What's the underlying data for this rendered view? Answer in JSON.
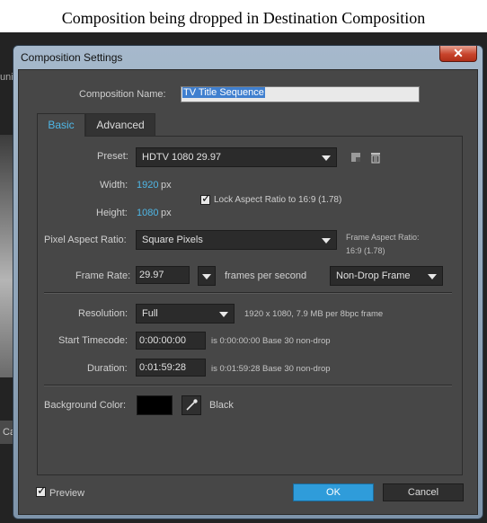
{
  "caption": "Composition being dropped in Destination Composition",
  "background_app": {
    "tab_label": "Ca",
    "partial_text": "uni"
  },
  "dialog": {
    "title": "Composition Settings",
    "close_symbol": "✕",
    "composition_name_label": "Composition Name:",
    "composition_name_value": "TV Title Sequence",
    "tabs": [
      "Basic",
      "Advanced"
    ],
    "preset_label": "Preset:",
    "preset_value": "HDTV 1080 29.97",
    "width_label": "Width:",
    "width_value": "1920",
    "height_label": "Height:",
    "height_value": "1080",
    "unit_px": "px",
    "lock_aspect_label": "Lock Aspect Ratio to 16:9 (1.78)",
    "lock_aspect_checked": true,
    "par_label": "Pixel Aspect Ratio:",
    "par_value": "Square Pixels",
    "frame_aspect_label": "Frame Aspect Ratio:",
    "frame_aspect_value": "16:9 (1.78)",
    "frame_rate_label": "Frame Rate:",
    "frame_rate_value": "29.97",
    "fps_label": "frames per second",
    "drop_frame_value": "Non-Drop Frame",
    "resolution_label": "Resolution:",
    "resolution_value": "Full",
    "resolution_info": "1920 x 1080, 7.9 MB per 8bpc frame",
    "start_tc_label": "Start Timecode:",
    "start_tc_value": "0:00:00:00",
    "start_tc_info": "is 0:00:00:00  Base 30  non-drop",
    "duration_label": "Duration:",
    "duration_value": "0:01:59:28",
    "duration_info": "is 0:01:59:28  Base 30  non-drop",
    "bg_color_label": "Background Color:",
    "bg_color_name": "Black",
    "bg_color_hex": "#000000",
    "preview_label": "Preview",
    "preview_checked": true,
    "ok_label": "OK",
    "cancel_label": "Cancel"
  },
  "colors": {
    "accent": "#4fb7e6",
    "ok_button": "#2f9cda",
    "dialog_bg": "#474747"
  }
}
